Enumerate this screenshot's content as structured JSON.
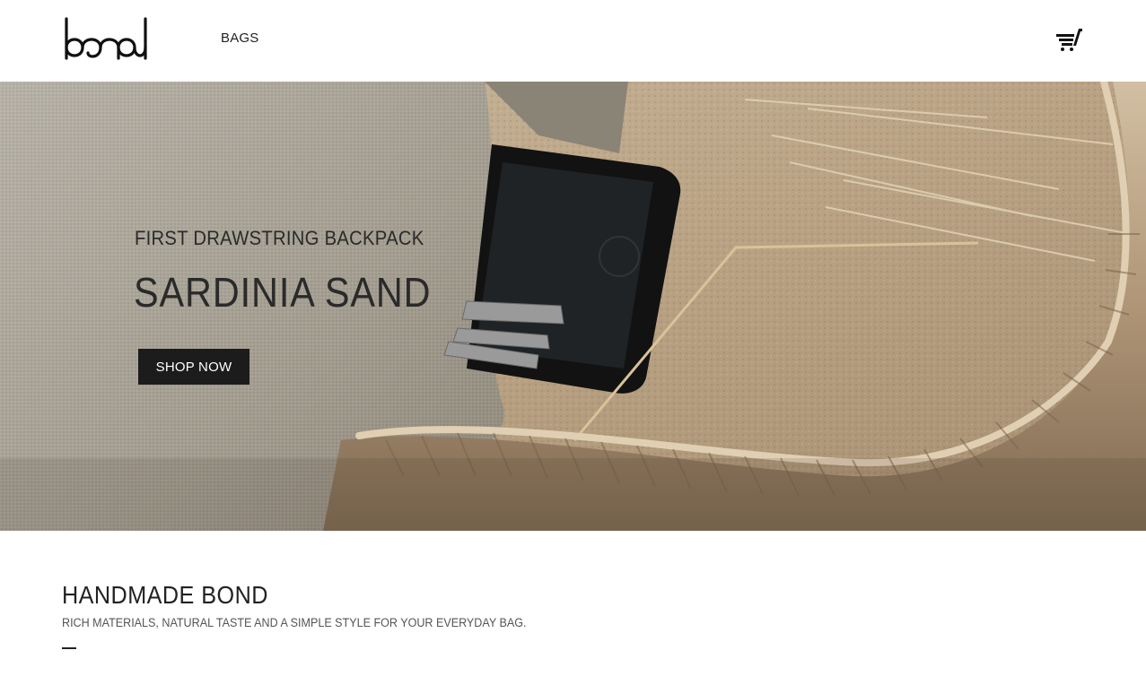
{
  "header": {
    "logo_text": "bond",
    "nav": [
      {
        "label": "BAGS"
      }
    ],
    "cart_icon": "shopping-cart-icon"
  },
  "hero": {
    "subtitle": "FIRST DRAWSTRING BACKPACK",
    "title": "SARDINIA SAND",
    "button_label": "SHOP NOW",
    "colors": {
      "sand": "#b8a387",
      "canvas": "#a59f93",
      "rope": "#b39a7a",
      "button": "#1c1c1c"
    }
  },
  "intro": {
    "title": "HANDMADE BOND",
    "text": "RICH MATERIALS, NATURAL TASTE AND A SIMPLE STYLE FOR YOUR EVERYDAY BAG."
  }
}
